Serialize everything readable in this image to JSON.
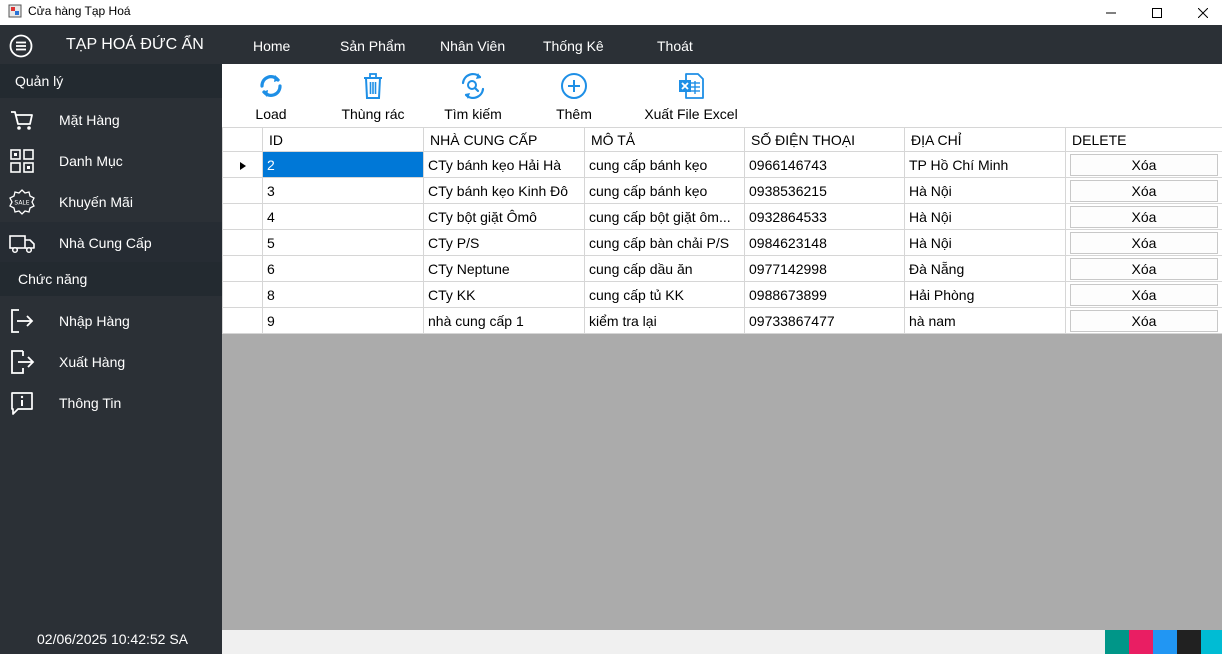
{
  "window": {
    "title": "Cửa hàng Tạp Hoá",
    "minimize_glyph": "—",
    "maximize_glyph": "☐",
    "close_glyph": "✕"
  },
  "brand": "TẠP HOÁ ĐỨC ẨN",
  "nav": {
    "home": "Home",
    "san_pham": "Sản Phẩm",
    "nhan_vien": "Nhân Viên",
    "thong_ke": "Thống Kê",
    "thoat": "Thoát"
  },
  "sidebar": {
    "section_quanly": "Quản lý",
    "section_chucnang": "Chức năng",
    "items": {
      "mat_hang": "Mặt Hàng",
      "danh_muc": "Danh Mục",
      "khuyen_mai": "Khuyến Mãi",
      "nha_cung_cap": "Nhà Cung Cấp",
      "nhap_hang": "Nhập Hàng",
      "xuat_hang": "Xuất Hàng",
      "thong_tin": "Thông Tin"
    },
    "sale_icon_text": "SALE",
    "clock": "02/06/2025 10:42:52 SA"
  },
  "toolbar": {
    "load": "Load",
    "trash": "Thùng rác",
    "search": "Tìm kiếm",
    "add": "Thêm",
    "excel": "Xuất File Excel"
  },
  "grid": {
    "columns": {
      "id": "ID",
      "nha_cung_cap": "NHÀ CUNG CẤP",
      "mo_ta": "MÔ TẢ",
      "so_dien_thoai": "SỐ ĐIỆN THOẠI",
      "dia_chi": "ĐỊA CHỈ",
      "delete": "DELETE"
    },
    "delete_label": "Xóa",
    "rows": [
      {
        "id": "2",
        "name": "CTy bánh kẹo Hải Hà",
        "desc": "cung cấp bánh kẹo",
        "phone": "0966146743",
        "addr": "TP Hồ Chí Minh"
      },
      {
        "id": "3",
        "name": "CTy bánh kẹo Kinh Đô",
        "desc": "cung cấp bánh kẹo",
        "phone": "0938536215",
        "addr": "Hà Nội"
      },
      {
        "id": "4",
        "name": "CTy bột giặt Ômô",
        "desc": "cung cấp bột giặt ôm...",
        "phone": "0932864533",
        "addr": "Hà Nội"
      },
      {
        "id": "5",
        "name": "CTy P/S",
        "desc": "cung cấp bàn chải P/S",
        "phone": "0984623148",
        "addr": "Hà Nội"
      },
      {
        "id": "6",
        "name": "CTy Neptune",
        "desc": "cung cấp dầu ăn",
        "phone": "0977142998",
        "addr": "Đà Nẵng"
      },
      {
        "id": "8",
        "name": "CTy KK",
        "desc": "cung cấp tủ KK",
        "phone": "0988673899",
        "addr": "Hải Phòng"
      },
      {
        "id": "9",
        "name": "nhà cung cấp 1",
        "desc": "kiểm tra lại",
        "phone": "09733867477",
        "addr": "hà nam"
      }
    ]
  },
  "colors": {
    "sidebar_bg": "#2b3036",
    "section_bg": "#232a30",
    "selection": "#0078d7",
    "grid_empty_bg": "#ababab",
    "icon_blue": "#1e8fe6",
    "swatches": [
      "#009688",
      "#e91e63",
      "#2196f3",
      "#212121",
      "#00bcd4"
    ]
  }
}
